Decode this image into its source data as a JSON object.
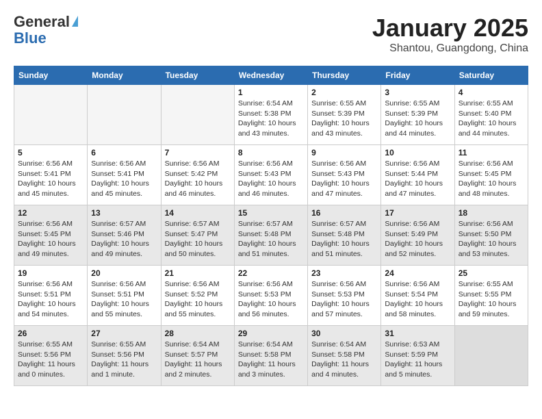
{
  "header": {
    "logo_general": "General",
    "logo_blue": "Blue",
    "month_title": "January 2025",
    "subtitle": "Shantou, Guangdong, China"
  },
  "days_of_week": [
    "Sunday",
    "Monday",
    "Tuesday",
    "Wednesday",
    "Thursday",
    "Friday",
    "Saturday"
  ],
  "weeks": [
    {
      "shaded": false,
      "days": [
        {
          "num": "",
          "empty": true
        },
        {
          "num": "",
          "empty": true
        },
        {
          "num": "",
          "empty": true
        },
        {
          "num": "1",
          "sunrise": "6:54 AM",
          "sunset": "5:38 PM",
          "daylight": "10 hours and 43 minutes."
        },
        {
          "num": "2",
          "sunrise": "6:55 AM",
          "sunset": "5:39 PM",
          "daylight": "10 hours and 43 minutes."
        },
        {
          "num": "3",
          "sunrise": "6:55 AM",
          "sunset": "5:39 PM",
          "daylight": "10 hours and 44 minutes."
        },
        {
          "num": "4",
          "sunrise": "6:55 AM",
          "sunset": "5:40 PM",
          "daylight": "10 hours and 44 minutes."
        }
      ]
    },
    {
      "shaded": false,
      "days": [
        {
          "num": "5",
          "sunrise": "6:56 AM",
          "sunset": "5:41 PM",
          "daylight": "10 hours and 45 minutes."
        },
        {
          "num": "6",
          "sunrise": "6:56 AM",
          "sunset": "5:41 PM",
          "daylight": "10 hours and 45 minutes."
        },
        {
          "num": "7",
          "sunrise": "6:56 AM",
          "sunset": "5:42 PM",
          "daylight": "10 hours and 46 minutes."
        },
        {
          "num": "8",
          "sunrise": "6:56 AM",
          "sunset": "5:43 PM",
          "daylight": "10 hours and 46 minutes."
        },
        {
          "num": "9",
          "sunrise": "6:56 AM",
          "sunset": "5:43 PM",
          "daylight": "10 hours and 47 minutes."
        },
        {
          "num": "10",
          "sunrise": "6:56 AM",
          "sunset": "5:44 PM",
          "daylight": "10 hours and 47 minutes."
        },
        {
          "num": "11",
          "sunrise": "6:56 AM",
          "sunset": "5:45 PM",
          "daylight": "10 hours and 48 minutes."
        }
      ]
    },
    {
      "shaded": true,
      "days": [
        {
          "num": "12",
          "sunrise": "6:56 AM",
          "sunset": "5:45 PM",
          "daylight": "10 hours and 49 minutes."
        },
        {
          "num": "13",
          "sunrise": "6:57 AM",
          "sunset": "5:46 PM",
          "daylight": "10 hours and 49 minutes."
        },
        {
          "num": "14",
          "sunrise": "6:57 AM",
          "sunset": "5:47 PM",
          "daylight": "10 hours and 50 minutes."
        },
        {
          "num": "15",
          "sunrise": "6:57 AM",
          "sunset": "5:48 PM",
          "daylight": "10 hours and 51 minutes."
        },
        {
          "num": "16",
          "sunrise": "6:57 AM",
          "sunset": "5:48 PM",
          "daylight": "10 hours and 51 minutes."
        },
        {
          "num": "17",
          "sunrise": "6:56 AM",
          "sunset": "5:49 PM",
          "daylight": "10 hours and 52 minutes."
        },
        {
          "num": "18",
          "sunrise": "6:56 AM",
          "sunset": "5:50 PM",
          "daylight": "10 hours and 53 minutes."
        }
      ]
    },
    {
      "shaded": false,
      "days": [
        {
          "num": "19",
          "sunrise": "6:56 AM",
          "sunset": "5:51 PM",
          "daylight": "10 hours and 54 minutes."
        },
        {
          "num": "20",
          "sunrise": "6:56 AM",
          "sunset": "5:51 PM",
          "daylight": "10 hours and 55 minutes."
        },
        {
          "num": "21",
          "sunrise": "6:56 AM",
          "sunset": "5:52 PM",
          "daylight": "10 hours and 55 minutes."
        },
        {
          "num": "22",
          "sunrise": "6:56 AM",
          "sunset": "5:53 PM",
          "daylight": "10 hours and 56 minutes."
        },
        {
          "num": "23",
          "sunrise": "6:56 AM",
          "sunset": "5:53 PM",
          "daylight": "10 hours and 57 minutes."
        },
        {
          "num": "24",
          "sunrise": "6:56 AM",
          "sunset": "5:54 PM",
          "daylight": "10 hours and 58 minutes."
        },
        {
          "num": "25",
          "sunrise": "6:55 AM",
          "sunset": "5:55 PM",
          "daylight": "10 hours and 59 minutes."
        }
      ]
    },
    {
      "shaded": true,
      "days": [
        {
          "num": "26",
          "sunrise": "6:55 AM",
          "sunset": "5:56 PM",
          "daylight": "11 hours and 0 minutes."
        },
        {
          "num": "27",
          "sunrise": "6:55 AM",
          "sunset": "5:56 PM",
          "daylight": "11 hours and 1 minute."
        },
        {
          "num": "28",
          "sunrise": "6:54 AM",
          "sunset": "5:57 PM",
          "daylight": "11 hours and 2 minutes."
        },
        {
          "num": "29",
          "sunrise": "6:54 AM",
          "sunset": "5:58 PM",
          "daylight": "11 hours and 3 minutes."
        },
        {
          "num": "30",
          "sunrise": "6:54 AM",
          "sunset": "5:58 PM",
          "daylight": "11 hours and 4 minutes."
        },
        {
          "num": "31",
          "sunrise": "6:53 AM",
          "sunset": "5:59 PM",
          "daylight": "11 hours and 5 minutes."
        },
        {
          "num": "",
          "empty": true
        }
      ]
    }
  ]
}
